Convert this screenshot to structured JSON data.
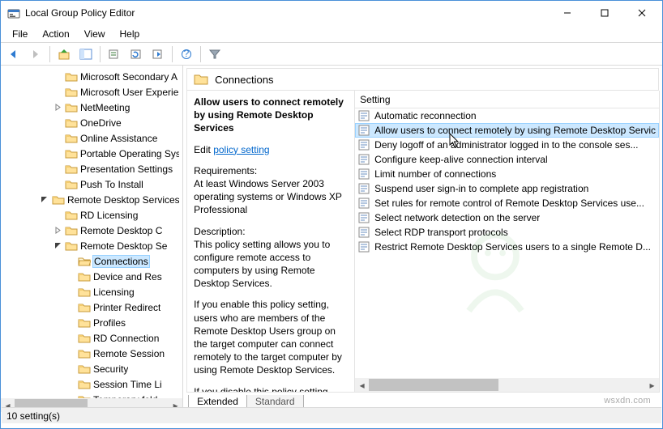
{
  "window": {
    "title": "Local Group Policy Editor"
  },
  "menu": {
    "file": "File",
    "action": "Action",
    "view": "View",
    "help": "Help"
  },
  "toolbar": {
    "back": "back",
    "fwd": "forward",
    "up": "up",
    "props_tree": "show/hide-tree",
    "props": "properties",
    "refresh": "refresh",
    "export": "export",
    "help": "help",
    "filter": "filter"
  },
  "tree": {
    "items": [
      {
        "indent": 4,
        "name": "Microsoft Secondary A"
      },
      {
        "indent": 4,
        "name": "Microsoft User Experie"
      },
      {
        "indent": 4,
        "name": "NetMeeting",
        "expandable": true
      },
      {
        "indent": 4,
        "name": "OneDrive"
      },
      {
        "indent": 4,
        "name": "Online Assistance"
      },
      {
        "indent": 4,
        "name": "Portable Operating Sys"
      },
      {
        "indent": 4,
        "name": "Presentation Settings"
      },
      {
        "indent": 4,
        "name": "Push To Install"
      },
      {
        "indent": 3,
        "name": "Remote Desktop Services",
        "expandable": true,
        "expanded": true
      },
      {
        "indent": 4,
        "name": "RD Licensing"
      },
      {
        "indent": 4,
        "name": "Remote Desktop C",
        "expandable": true
      },
      {
        "indent": 4,
        "name": "Remote Desktop Se",
        "expandable": true,
        "expanded": true
      },
      {
        "indent": 5,
        "name": "Connections",
        "selected": true,
        "open": true
      },
      {
        "indent": 5,
        "name": "Device and Res"
      },
      {
        "indent": 5,
        "name": "Licensing"
      },
      {
        "indent": 5,
        "name": "Printer Redirect"
      },
      {
        "indent": 5,
        "name": "Profiles"
      },
      {
        "indent": 5,
        "name": "RD Connection"
      },
      {
        "indent": 5,
        "name": "Remote Session"
      },
      {
        "indent": 5,
        "name": "Security"
      },
      {
        "indent": 5,
        "name": "Session Time Li"
      },
      {
        "indent": 5,
        "name": "Temporary fold"
      }
    ]
  },
  "details": {
    "header": "Connections",
    "selected_title": "Allow users to connect remotely by using Remote Desktop Services",
    "edit_label": "Edit",
    "edit_link": "policy setting",
    "requirements_label": "Requirements:",
    "requirements_body": "At least Windows Server 2003 operating systems or Windows XP Professional",
    "description_label": "Description:",
    "description_body1": "This policy setting allows you to configure remote access to computers by using Remote Desktop Services.",
    "description_body2": "If you enable this policy setting, users who are members of the Remote Desktop Users group on the target computer can connect remotely to the target computer by using Remote Desktop Services.",
    "description_body3": "If you disable this policy setting,"
  },
  "list": {
    "column": "Setting",
    "items": [
      "Automatic reconnection",
      "Allow users to connect remotely by using Remote Desktop Servic",
      "Deny logoff of an administrator logged in to the console ses...",
      "Configure keep-alive connection interval",
      "Limit number of connections",
      "Suspend user sign-in to complete app registration",
      "Set rules for remote control of Remote Desktop Services use...",
      "Select network detection on the server",
      "Select RDP transport protocols",
      "Restrict Remote Desktop Services users to a single Remote D..."
    ],
    "selected_index": 1
  },
  "tabs": {
    "extended": "Extended",
    "standard": "Standard"
  },
  "status": {
    "text": "10 setting(s)"
  },
  "watermark": "wsxdn.com"
}
